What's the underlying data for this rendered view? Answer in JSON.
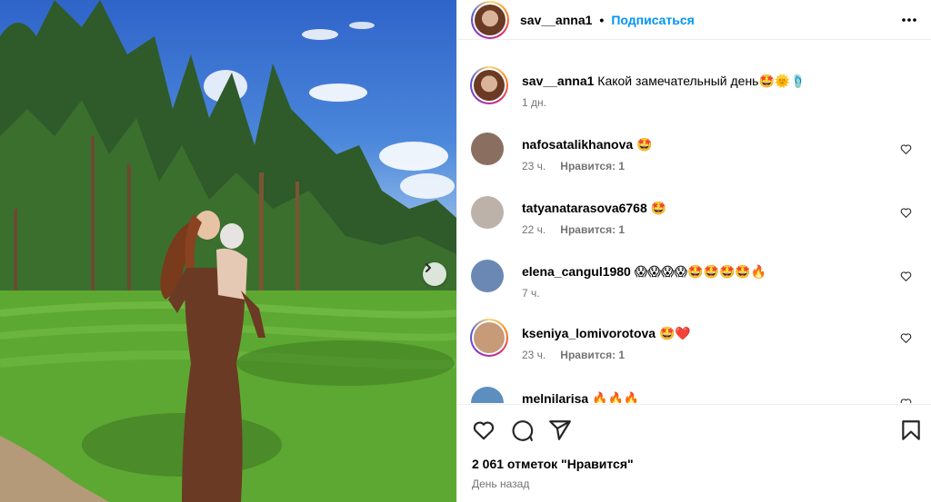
{
  "post": {
    "author": "sav__anna1",
    "dot": "•",
    "follow_label": "Подписаться",
    "caption": {
      "username": "sav__anna1",
      "text": "Какой замечательный день🤩🌞🩴",
      "time": "1 дн."
    }
  },
  "comments": [
    {
      "username": "nafosatalikhanova",
      "text": "🤩",
      "time": "23 ч.",
      "likes": "Нравится: 1",
      "avatar_color": "#8a6f60"
    },
    {
      "username": "tatyanatarasova6768",
      "text": "🤩",
      "time": "22 ч.",
      "likes": "Нравится: 1",
      "avatar_color": "#bdb2aa"
    },
    {
      "username": "elena_cangul1980",
      "text": "😱😱😱😱🤩🤩🤩🤩🔥",
      "time": "7 ч.",
      "likes": "",
      "avatar_color": "#6b88b5"
    },
    {
      "username": "kseniya_lomivorotova",
      "text": "🤩❤️",
      "time": "23 ч.",
      "likes": "Нравится: 1",
      "avatar_color": "#c79a78"
    },
    {
      "username": "melnilarisa",
      "text": "🔥🔥🔥",
      "time": "",
      "likes": "",
      "avatar_color": "#5c8fbf"
    }
  ],
  "footer": {
    "likes_count": "2 061 отметок \"Нравится\"",
    "posted": "День назад"
  },
  "icons": {
    "more": "more-horizontal-icon",
    "like": "heart-icon",
    "comment": "comment-icon",
    "share": "send-icon",
    "save": "bookmark-icon",
    "next": "chevron-right-icon"
  },
  "colors": {
    "follow_blue": "#0095f6",
    "muted_text": "#737373"
  }
}
